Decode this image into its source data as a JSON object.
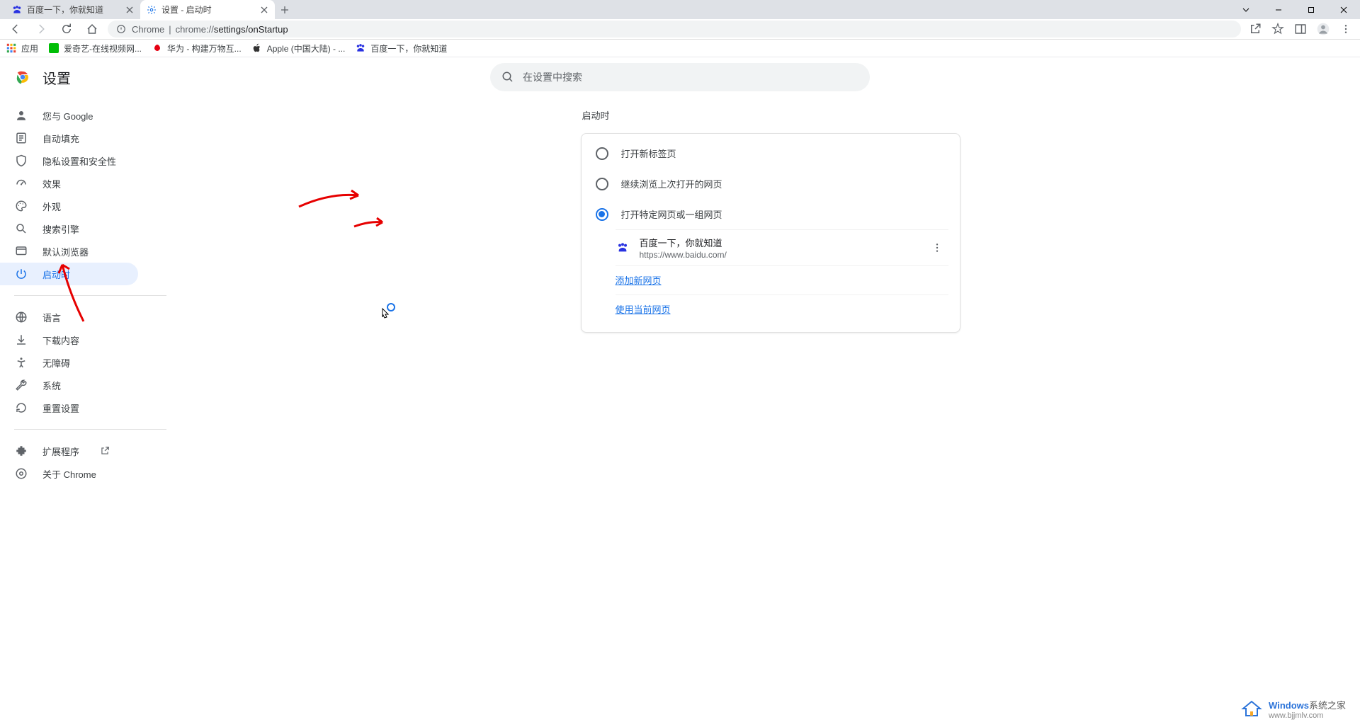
{
  "tabs": [
    {
      "title": "百度一下，你就知道",
      "active": false
    },
    {
      "title": "设置 - 启动时",
      "active": true
    }
  ],
  "omnibox": {
    "secure_label": "Chrome",
    "url_prefix": "chrome://",
    "url_path": "settings/onStartup"
  },
  "bookmarks": {
    "apps": "应用",
    "items": [
      "爱奇艺-在线视频网...",
      "华为 - 构建万物互...",
      "Apple (中国大陆) - ...",
      "百度一下，你就知道"
    ]
  },
  "settings": {
    "title": "设置",
    "search_placeholder": "在设置中搜索"
  },
  "sidebar": {
    "group1": [
      {
        "label": "您与 Google",
        "icon": "person"
      },
      {
        "label": "自动填充",
        "icon": "autofill"
      },
      {
        "label": "隐私设置和安全性",
        "icon": "shield"
      },
      {
        "label": "效果",
        "icon": "speed"
      },
      {
        "label": "外观",
        "icon": "palette"
      },
      {
        "label": "搜索引擎",
        "icon": "search"
      },
      {
        "label": "默认浏览器",
        "icon": "browser"
      },
      {
        "label": "启动时",
        "icon": "power",
        "active": true
      }
    ],
    "group2": [
      {
        "label": "语言",
        "icon": "globe"
      },
      {
        "label": "下载内容",
        "icon": "download"
      },
      {
        "label": "无障碍",
        "icon": "accessibility"
      },
      {
        "label": "系统",
        "icon": "wrench"
      },
      {
        "label": "重置设置",
        "icon": "reset"
      }
    ],
    "group3": [
      {
        "label": "扩展程序",
        "icon": "extension",
        "external": true
      },
      {
        "label": "关于 Chrome",
        "icon": "info"
      }
    ]
  },
  "main": {
    "section_title": "启动时",
    "options": [
      {
        "label": "打开新标签页",
        "selected": false
      },
      {
        "label": "继续浏览上次打开的网页",
        "selected": false
      },
      {
        "label": "打开特定网页或一组网页",
        "selected": true
      }
    ],
    "page_entry": {
      "title": "百度一下，你就知道",
      "url": "https://www.baidu.com/"
    },
    "add_page": "添加新网页",
    "use_current": "使用当前网页"
  },
  "watermark": {
    "brand1": "Windows",
    "brand2": "系统之家",
    "sub": "www.bjjmlv.com"
  }
}
